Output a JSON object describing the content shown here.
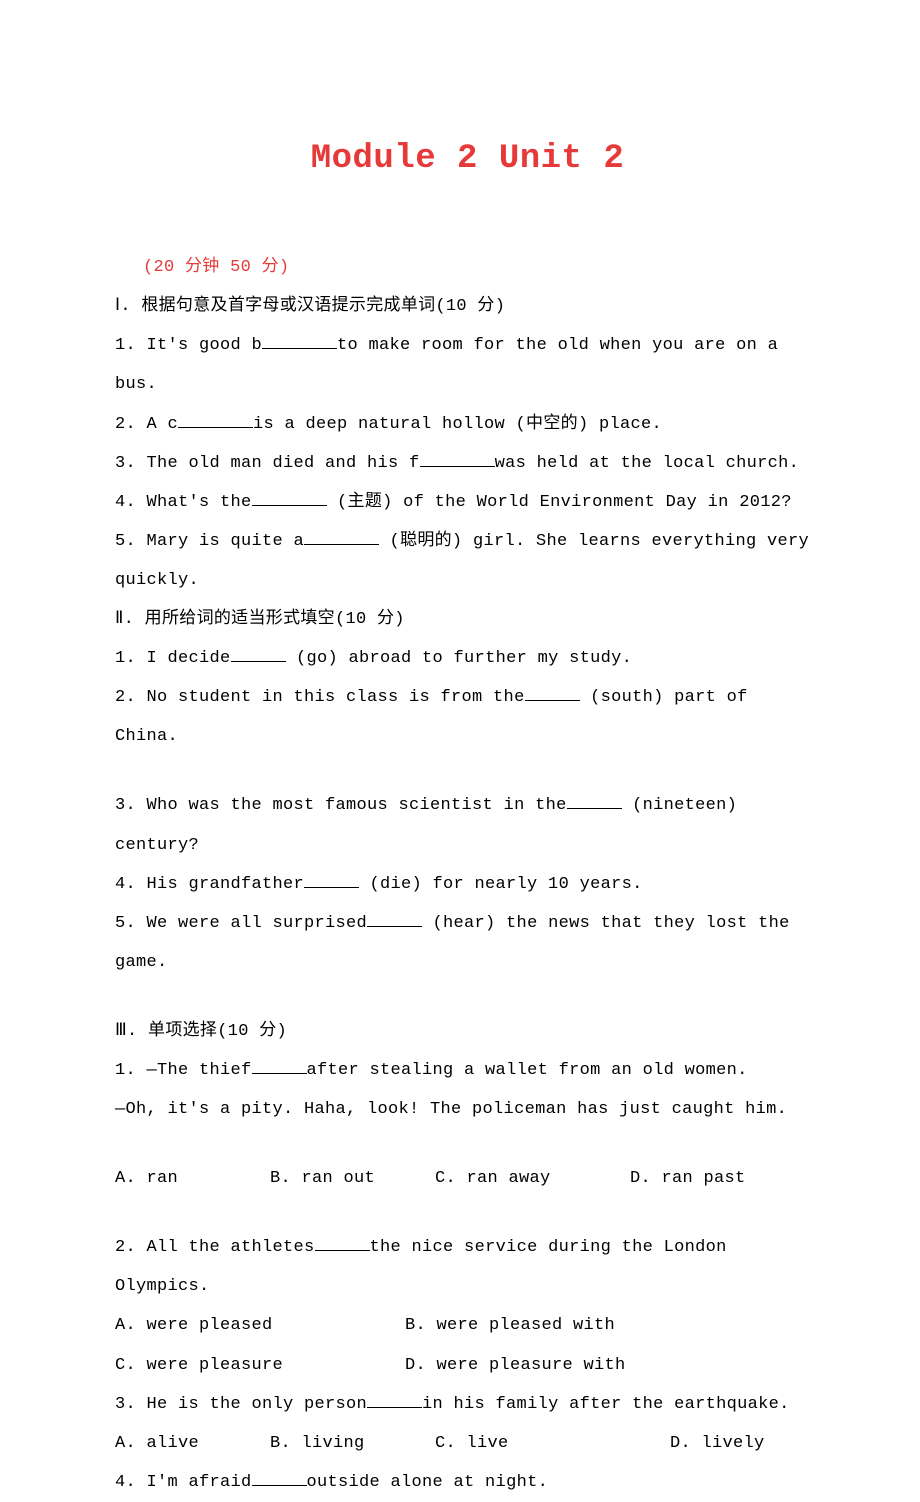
{
  "title": "Module 2  Unit 2",
  "subtitle": "(20 分钟  50 分)",
  "S1": {
    "header": "Ⅰ. 根据句意及首字母或汉语提示完成单词(10 分)",
    "q1a": "1. It's good b",
    "q1b": "to make room for the old when you are on a bus.",
    "q2a": "2. A c",
    "q2b": "is a deep natural hollow (中空的) place.",
    "q3a": "3. The old man died and his f",
    "q3b": "was held at the local church.",
    "q4a": "4. What's the",
    "q4b": " (主题) of the World Environment Day in 2012?",
    "q5a": "5. Mary is quite a",
    "q5b": " (聪明的) girl. She learns everything very quickly."
  },
  "S2": {
    "header": "Ⅱ. 用所给词的适当形式填空(10 分)",
    "q1a": "1. I decide",
    "q1b": " (go) abroad to further my study.",
    "q2a": "2. No student in this class is from the",
    "q2b": " (south) part of China.",
    "q3a": "3. Who was the most famous scientist in the",
    "q3b": " (nineteen) century?",
    "q4a": "4. His grandfather",
    "q4b": " (die) for nearly 10 years. ",
    "q5a": "5. We were all surprised",
    "q5b": " (hear) the news that they lost the game."
  },
  "S3": {
    "header": "Ⅲ. 单项选择(10 分)",
    "q1a": "1. —The thief",
    "q1b": "after stealing a wallet from an old women.",
    "q1c": "—Oh, it's a pity. Haha, look! The policeman has just caught him.",
    "q1A": "A. ran",
    "q1B": "B. ran out",
    "q1C": "C. ran away",
    "q1D": "D. ran past",
    "q2a": "2. All the athletes",
    "q2b": "the nice service during the London Olympics.",
    "q2A": "A. were pleased",
    "q2B": "B. were pleased with",
    "q2C": "C. were pleasure",
    "q2D": "D. were pleasure with",
    "q3a": "3. He is the only person",
    "q3b": "in his family after the earthquake.",
    "q3A": "A. alive",
    "q3B": "B. living",
    "q3C": "C. live",
    "q3D": "D. lively",
    "q4a": "4. I'm afraid",
    "q4b": "outside alone at night."
  }
}
